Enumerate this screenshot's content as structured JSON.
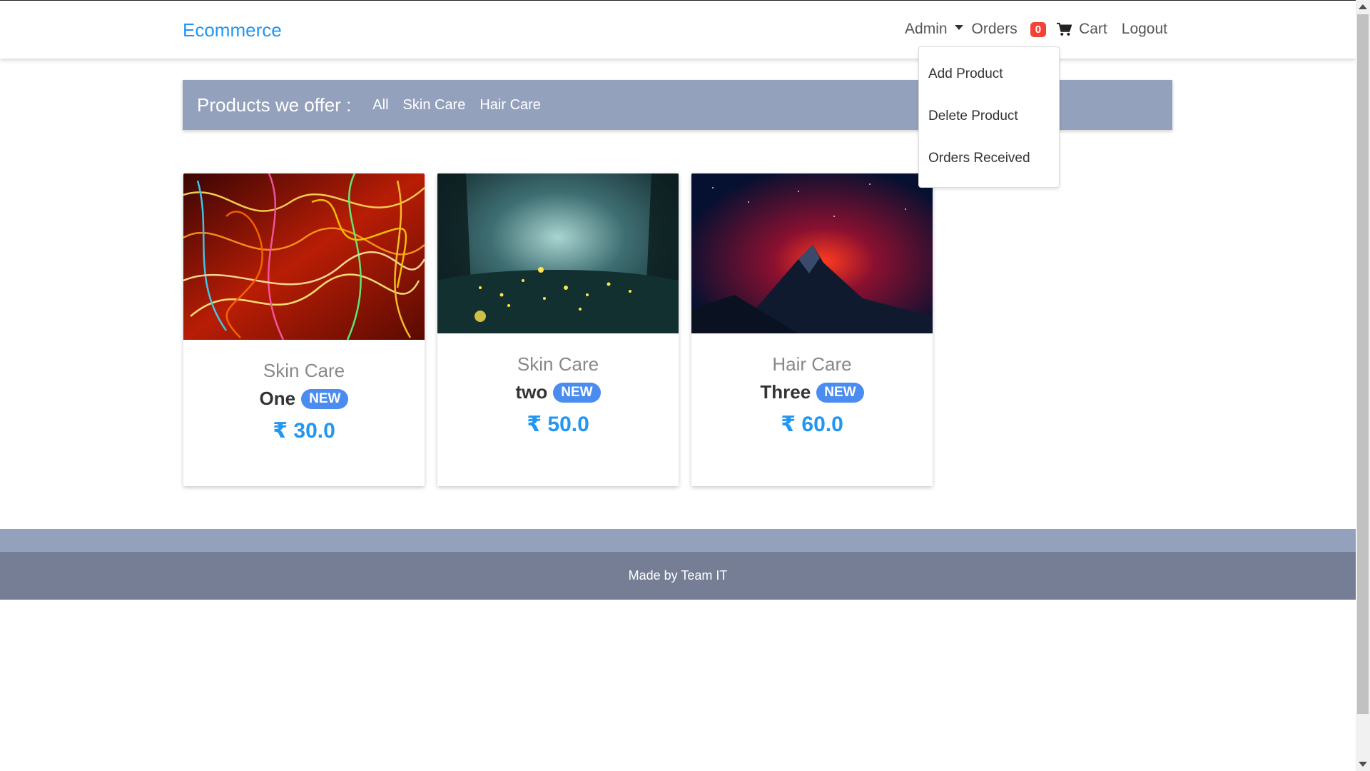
{
  "navbar": {
    "brand": "Ecommerce",
    "admin_label": "Admin",
    "orders_label": "Orders",
    "orders_count": "0",
    "cart_label": "Cart",
    "logout_label": "Logout"
  },
  "admin_menu": {
    "items": [
      "Add Product",
      "Delete Product",
      "Orders Received"
    ]
  },
  "filter": {
    "title": "Products we offer :",
    "links": [
      "All",
      "Skin Care",
      "Hair Care"
    ]
  },
  "products": [
    {
      "category": "Skin Care",
      "name": "One",
      "badge": "NEW",
      "price": "₹ 30.0",
      "image": "colorful-light-trails"
    },
    {
      "category": "Skin Care",
      "name": "two",
      "badge": "NEW",
      "price": "₹ 50.0",
      "image": "forest-fireflies"
    },
    {
      "category": "Hair Care",
      "name": "Three",
      "badge": "NEW",
      "price": "₹ 60.0",
      "image": "mountain-aurora"
    }
  ],
  "footer": {
    "text": "Made by Team IT"
  },
  "colors": {
    "brand": "#2196f3",
    "filter_bar": "#93a1bd",
    "footer_bottom": "#767e96",
    "badge_red": "#f44336",
    "badge_new": "#4a8cf0"
  }
}
